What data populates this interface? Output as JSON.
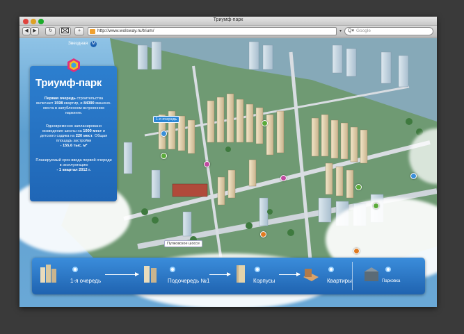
{
  "browser": {
    "window_title": "Триумф-парк",
    "url": "http://www.wolsway.ru/trium/",
    "search_placeholder": "Google",
    "back_label": "◀",
    "forward_label": "▶",
    "reload_label": "↻",
    "add_label": "+"
  },
  "top_nav": {
    "label": "Звездная",
    "metro_badge": "М"
  },
  "info": {
    "title": "Триумф-парк",
    "p1_a": "Первая очередь",
    "p1_b": " строительства включает ",
    "p1_c": "1598",
    "p1_d": " квартир, и ",
    "p1_e": "84390",
    "p1_f": " машино-места в запубленном встроенном паркинге.",
    "p2_a": "Одновременно запланировано возведение школы на ",
    "p2_b": "1000 мест",
    "p2_c": " и детского садика на ",
    "p2_d": "220 мест",
    "p2_e": ". Общая площадь застройки",
    "p2_f": "- 155,6 тыс. м²",
    "p3_a": "Планируемый срок ввода первой очереди в эксплуатацию",
    "p3_b": "- 1 квартал 2012 г."
  },
  "map_labels": {
    "queue": "1-я очередь",
    "highway": "Пулковское шоссе"
  },
  "bottom_nav": {
    "steps": [
      {
        "label": "1-я очередь"
      },
      {
        "label": "Подочередь №1"
      },
      {
        "label": "Корпусы"
      },
      {
        "label": "Квартиры"
      }
    ],
    "parking_label": "Парковка"
  },
  "colors": {
    "accent": "#2a7fd0",
    "panel": "#1f66b6"
  }
}
